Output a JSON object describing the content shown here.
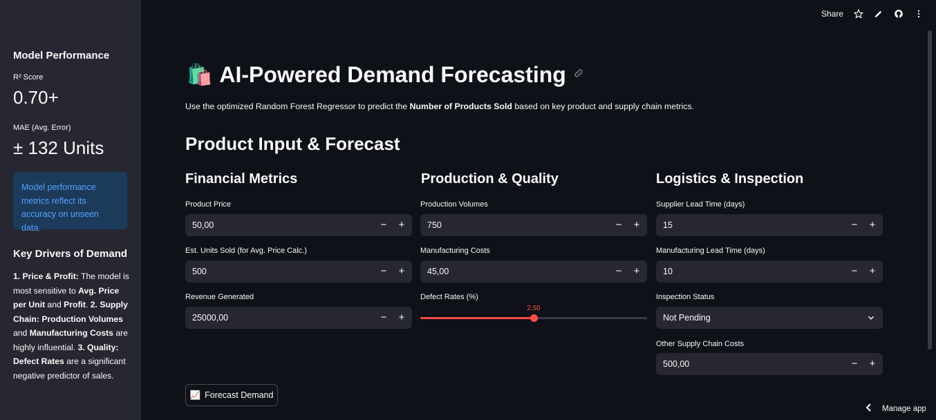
{
  "toolbar": {
    "share_label": "Share"
  },
  "sidebar": {
    "model_heading": "Model Performance",
    "r2_label": "R² Score",
    "r2_value": "0.70+",
    "mae_label": "MAE (Avg. Error)",
    "mae_value": "± 132 Units",
    "info_text": "Model performance metrics reflect its accuracy on unseen data.",
    "drivers_heading": "Key Drivers of Demand",
    "drivers": {
      "p1_bold": "1. Price & Profit:",
      "p1_text": " The model is most sensitive to ",
      "p1_b2": "Avg. Price per Unit",
      "p1_text2": " and ",
      "p1_b3": "Profit",
      "p1_text3": ". ",
      "p2_bold": "2. Supply Chain:",
      "p2_text": " ",
      "p2_b2": "Production Volumes",
      "p2_text2": " and ",
      "p2_b3": "Manufacturing Costs",
      "p2_text3": " are highly influential. ",
      "p3_bold": "3. Quality:",
      "p3_text": " ",
      "p3_b2": "Defect Rates",
      "p3_text2": " are a significant negative predictor of sales."
    }
  },
  "main": {
    "title_emoji": "🛍️",
    "title": "AI-Powered Demand Forecasting",
    "intro_pre": "Use the optimized Random Forest Regressor to predict the ",
    "intro_bold": "Number of Products Sold",
    "intro_post": " based on key product and supply chain metrics.",
    "section_heading": "Product Input & Forecast",
    "columns": [
      {
        "heading": "Financial Metrics"
      },
      {
        "heading": "Production & Quality"
      },
      {
        "heading": "Logistics & Inspection"
      }
    ],
    "fields": {
      "product_price": {
        "label": "Product Price",
        "value": "50,00"
      },
      "est_units": {
        "label": "Est. Units Sold (for Avg. Price Calc.)",
        "value": "500"
      },
      "revenue": {
        "label": "Revenue Generated",
        "value": "25000,00"
      },
      "production_volumes": {
        "label": "Production Volumes",
        "value": "750"
      },
      "manufacturing_costs": {
        "label": "Manufacturing Costs",
        "value": "45,00"
      },
      "defect_rates": {
        "label": "Defect Rates (%)",
        "value": "2.50",
        "fraction": 0.5
      },
      "supplier_lead": {
        "label": "Supplier Lead Time (days)",
        "value": "15"
      },
      "mfg_lead": {
        "label": "Manufacturing Lead Time (days)",
        "value": "10"
      },
      "inspection": {
        "label": "Inspection Status",
        "value": "Not Pending"
      },
      "other_costs": {
        "label": "Other Supply Chain Costs",
        "value": "500,00"
      }
    },
    "stepper": {
      "minus": "−",
      "plus": "+"
    },
    "forecast_button": {
      "emoji": "📈",
      "label": "Forecast Demand"
    }
  },
  "footer": {
    "manage_label": "Manage app"
  },
  "colors": {
    "accent": "#ff4b4b",
    "info_bg": "#1c3a5a",
    "info_text": "#54a3ff",
    "sidebar_bg": "#262730",
    "main_bg": "#0e1117"
  }
}
